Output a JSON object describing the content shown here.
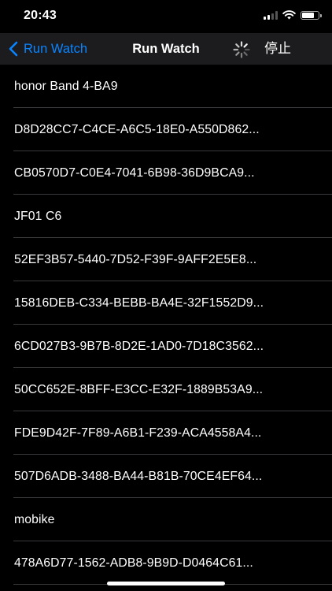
{
  "status_bar": {
    "time": "20:43",
    "signal_bars": 4,
    "signal_bars_active": 2,
    "battery_level": 0.85
  },
  "nav": {
    "back_label": "Run Watch",
    "title": "Run Watch",
    "stop_label": "停止",
    "back_icon": "chevron-left-icon",
    "spinner_icon": "activity-spinner-icon",
    "accent_color": "#0a84ff"
  },
  "devices": [
    {
      "label": "honor Band 4-BA9"
    },
    {
      "label": "D8D28CC7-C4CE-A6C5-18E0-A550D862..."
    },
    {
      "label": "CB0570D7-C0E4-7041-6B98-36D9BCA9..."
    },
    {
      "label": "JF01 C6"
    },
    {
      "label": "52EF3B57-5440-7D52-F39F-9AFF2E5E8..."
    },
    {
      "label": "15816DEB-C334-BEBB-BA4E-32F1552D9..."
    },
    {
      "label": "6CD027B3-9B7B-8D2E-1AD0-7D18C3562..."
    },
    {
      "label": "50CC652E-8BFF-E3CC-E32F-1889B53A9..."
    },
    {
      "label": "FDE9D42F-7F89-A6B1-F239-ACA4558A4..."
    },
    {
      "label": "507D6ADB-3488-BA44-B81B-70CE4EF64..."
    },
    {
      "label": "mobike"
    },
    {
      "label": "478A6D77-1562-ADB8-9B9D-D0464C61..."
    }
  ]
}
